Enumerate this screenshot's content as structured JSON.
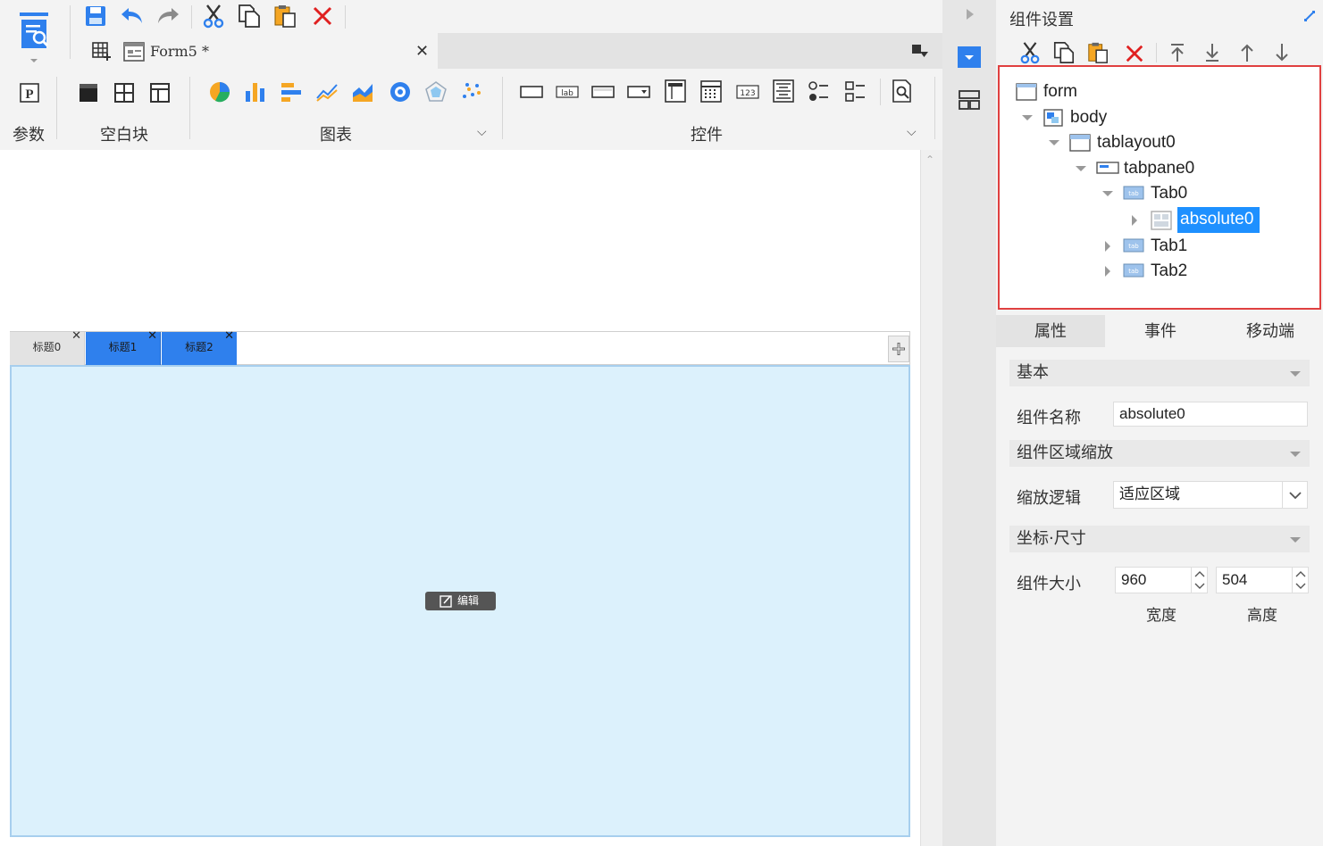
{
  "document": {
    "tab_title": "Form5 *"
  },
  "toolbar": {
    "groups": {
      "params": "参数",
      "blank": "空白块",
      "chart": "图表",
      "control": "控件"
    }
  },
  "form_tabs": [
    {
      "label": "标题0",
      "selected": false
    },
    {
      "label": "标题1",
      "selected": true
    },
    {
      "label": "标题2",
      "selected": true
    }
  ],
  "canvas": {
    "edit_label": "编辑"
  },
  "panel": {
    "title": "组件设置",
    "tree": [
      {
        "label": "form"
      },
      {
        "label": "body"
      },
      {
        "label": "tablayout0"
      },
      {
        "label": "tabpane0"
      },
      {
        "label": "Tab0"
      },
      {
        "label": "absolute0",
        "selected": true
      },
      {
        "label": "Tab1"
      },
      {
        "label": "Tab2"
      }
    ],
    "tabs": [
      "属性",
      "事件",
      "移动端"
    ],
    "sections": {
      "basic": "基本",
      "zoom": "组件区域缩放",
      "coords": "坐标·尺寸"
    },
    "fields": {
      "name_label": "组件名称",
      "name_value": "absolute0",
      "zoom_label": "缩放逻辑",
      "zoom_value": "适应区域",
      "size_label": "组件大小",
      "width_value": "960",
      "height_value": "504",
      "width_caption": "宽度",
      "height_caption": "高度"
    }
  },
  "colors": {
    "accent": "#2f80ed",
    "selection": "#1e90ff",
    "highlight_box": "#e04040",
    "tab_area": "#dcf1fc"
  }
}
